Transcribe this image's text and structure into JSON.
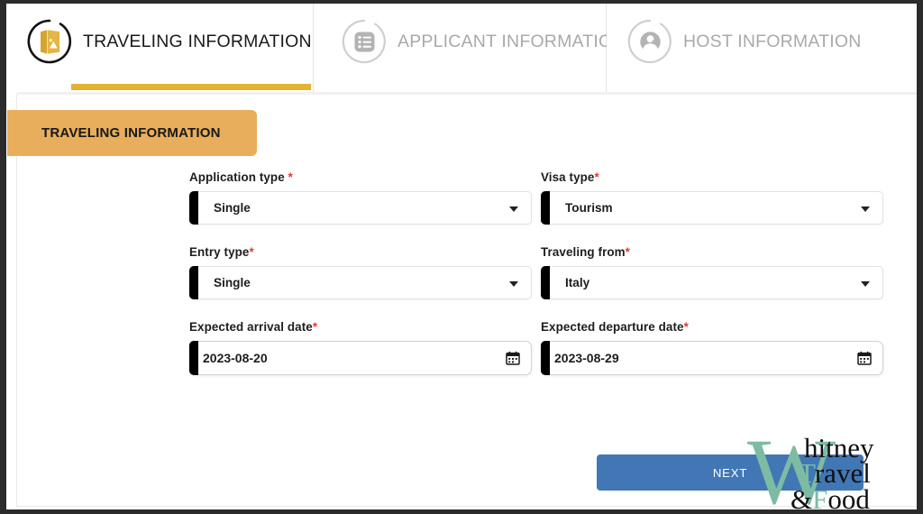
{
  "tabs": [
    {
      "label": "TRAVELING INFORMATION",
      "icon": "passport-icon",
      "active": true
    },
    {
      "label": "APPLICANT INFORMATION",
      "icon": "form-list-icon",
      "active": false
    },
    {
      "label": "HOST INFORMATION",
      "icon": "person-icon",
      "active": false
    }
  ],
  "section": {
    "banner_label": "TRAVELING INFORMATION",
    "banner_color": "#E8AE5B",
    "accent_color": "#E2B233"
  },
  "form": {
    "rows": [
      [
        {
          "label": "Application type ",
          "required": "*",
          "value": "Single",
          "type": "select",
          "name": "application-type"
        },
        {
          "label": "Visa type",
          "required": "*",
          "value": "Tourism",
          "type": "select",
          "name": "visa-type"
        }
      ],
      [
        {
          "label": "Entry type",
          "required": "*",
          "value": "Single",
          "type": "select",
          "name": "entry-type"
        },
        {
          "label": "Traveling from",
          "required": "*",
          "value": "Italy",
          "type": "select",
          "name": "traveling-from"
        }
      ],
      [
        {
          "label": "Expected arrival date",
          "required": "*",
          "value": "2023-08-20",
          "type": "date",
          "name": "expected-arrival-date"
        },
        {
          "label": "Expected departure date",
          "required": "*",
          "value": "2023-08-29",
          "type": "date",
          "name": "expected-departure-date"
        }
      ]
    ]
  },
  "actions": {
    "next_label": "NEXT",
    "next_color": "#4277B5"
  },
  "watermark": {
    "big_letter": "W",
    "line1": "hitney",
    "line2_cap": "T",
    "line2_rest": "ravel",
    "line3_amp": "&",
    "line3_cap": "F",
    "line3_rest": "ood",
    "color": "#7DBBA3"
  }
}
